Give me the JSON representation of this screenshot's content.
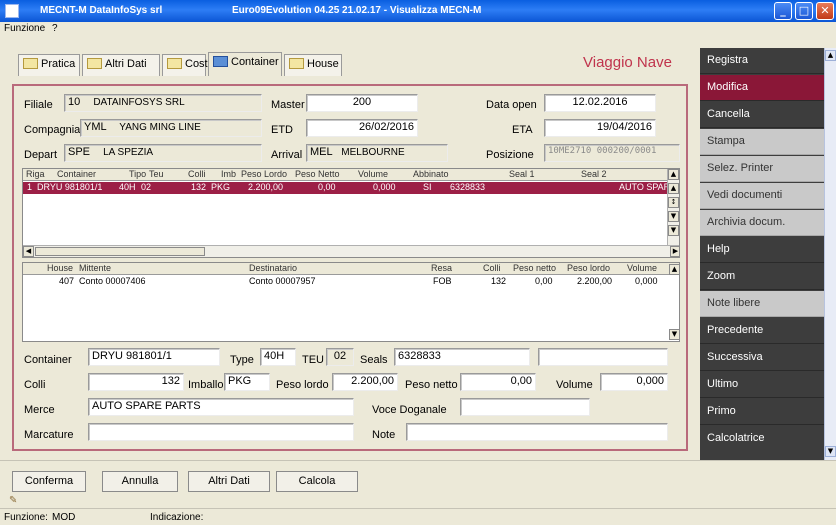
{
  "window": {
    "app_title": "MECNT-M DataInfoSys srl",
    "doc_title": "Euro09Evolution 04.25 21.02.17 - Visualizza MECN-M",
    "minimize": "_",
    "maximize": "□",
    "close": "✕"
  },
  "menu": {
    "funzione": "Funzione",
    "help": "?"
  },
  "tabs": [
    {
      "label": "Pratica"
    },
    {
      "label": "Altri Dati"
    },
    {
      "label": "Costi"
    },
    {
      "label": "Container"
    },
    {
      "label": "House"
    }
  ],
  "section_title": "Viaggio Nave",
  "header": {
    "filiale_label": "Filiale",
    "filiale_code": "10",
    "filiale_desc": "DATAINFOSYS SRL",
    "master_label": "Master",
    "master_value": "200",
    "data_open_label": "Data open",
    "data_open_value": "12.02.2016",
    "compagnia_label": "Compagnia",
    "compagnia_code": "YML",
    "compagnia_desc": "YANG MING LINE",
    "etd_label": "ETD",
    "etd_value": "26/02/2016",
    "eta_label": "ETA",
    "eta_value": "19/04/2016",
    "depart_label": "Depart",
    "depart_code": "SPE",
    "depart_desc": "LA SPEZIA",
    "arrival_label": "Arrival",
    "arrival_code": "MEL",
    "arrival_desc": "MELBOURNE",
    "posizione_label": "Posizione",
    "posizione_value": "10ME2710 000200/0001"
  },
  "container_grid": {
    "columns": [
      "Riga",
      "Container",
      "Tipo",
      "Teu",
      "Colli",
      "Imb",
      "Peso Lordo",
      "Peso Netto",
      "Volume",
      "Abbinato",
      "Seal 1",
      "Seal 2"
    ],
    "rows": [
      [
        "1",
        "DRYU 981801/1",
        "40H",
        "02",
        "132",
        "PKG",
        "2.200,00",
        "0,00",
        "0,000",
        "SI",
        "6328833",
        "AUTO SPARE"
      ]
    ]
  },
  "house_grid": {
    "columns": [
      "House",
      "Mittente",
      "Destinatario",
      "Resa",
      "Colli",
      "Peso netto",
      "Peso lordo",
      "Volume"
    ],
    "rows": [
      [
        "407",
        "Conto 00007406",
        "Conto 00007957",
        "FOB",
        "132",
        "0,00",
        "2.200,00",
        "0,000"
      ]
    ]
  },
  "detail": {
    "container_label": "Container",
    "container_value": "DRYU 981801/1",
    "type_label": "Type",
    "type_value": "40H",
    "teu_label": "TEU",
    "teu_value": "02",
    "seals_label": "Seals",
    "seals_value": "6328833",
    "seals2_value": "",
    "colli_label": "Colli",
    "colli_value": "132",
    "imballo_label": "Imballo",
    "imballo_value": "PKG",
    "peso_lordo_label": "Peso lordo",
    "peso_lordo_value": "2.200,00",
    "peso_netto_label": "Peso netto",
    "peso_netto_value": "0,00",
    "volume_label": "Volume",
    "volume_value": "0,000",
    "merce_label": "Merce",
    "merce_value": "AUTO SPARE PARTS",
    "voce_label": "Voce Doganale",
    "voce_value": "",
    "marcature_label": "Marcature",
    "marcature_value": "",
    "note_label": "Note",
    "note_value": ""
  },
  "sidebar": [
    {
      "label": "Registra"
    },
    {
      "label": "Modifica"
    },
    {
      "label": "Cancella"
    },
    {
      "label": "Stampa"
    },
    {
      "label": "Selez. Printer"
    },
    {
      "label": "Vedi documenti"
    },
    {
      "label": "Archivia docum."
    },
    {
      "label": "Help"
    },
    {
      "label": "Zoom"
    },
    {
      "label": "Note libere"
    },
    {
      "label": "Precedente"
    },
    {
      "label": "Successiva"
    },
    {
      "label": "Ultimo"
    },
    {
      "label": "Primo"
    },
    {
      "label": "Calcolatrice"
    }
  ],
  "buttons": {
    "conferma": "Conferma",
    "annulla": "Annulla",
    "altri_dati": "Altri Dati",
    "calcola": "Calcola"
  },
  "status": {
    "funzione_label": "Funzione:",
    "funzione_value": "MOD",
    "indicazione_label": "Indicazione:"
  },
  "colors": {
    "accent": "#9c1f46",
    "sidebar_bg": "#3d3d3d",
    "frame": "#b96a7b"
  }
}
